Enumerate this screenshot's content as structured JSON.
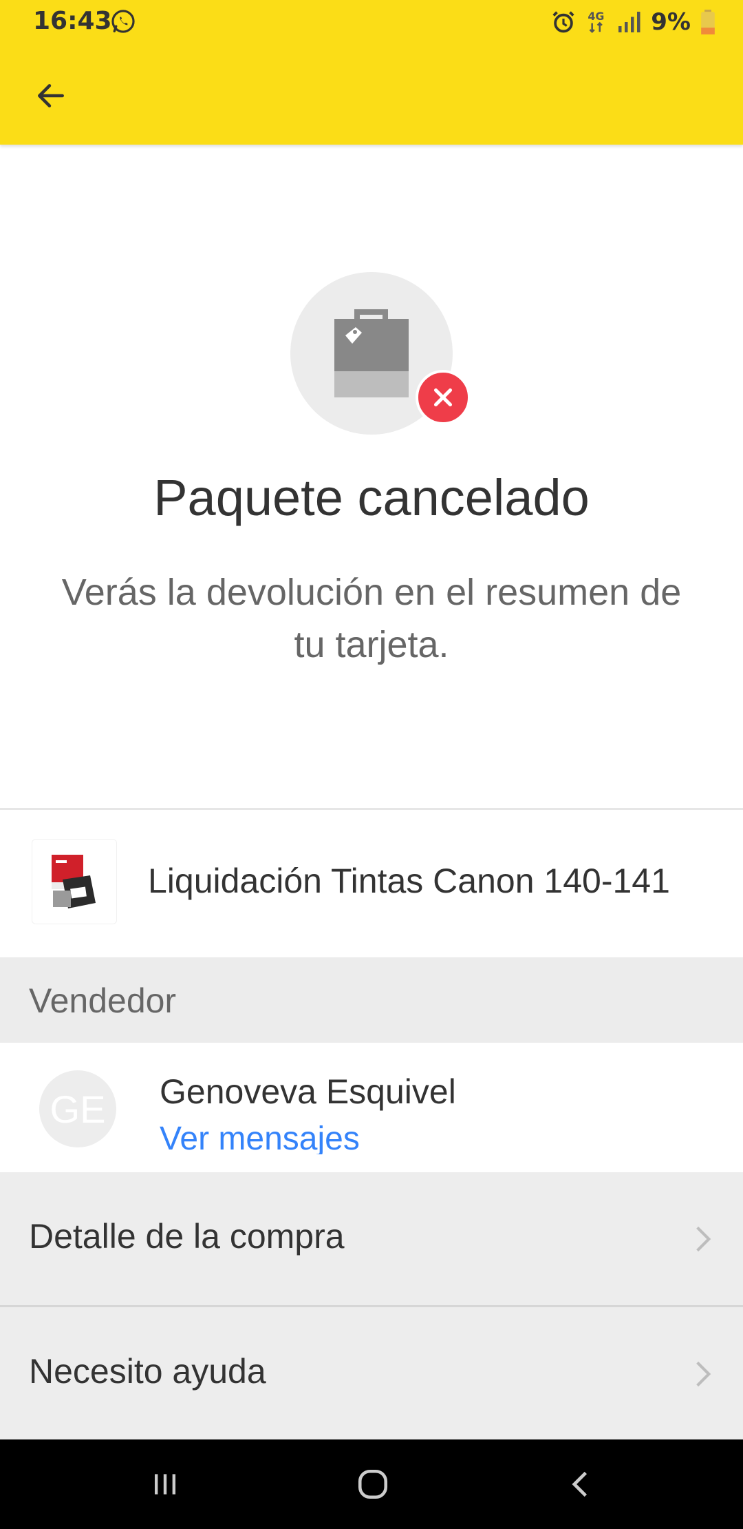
{
  "status_bar": {
    "time": "16:43",
    "battery_text": "9%",
    "network": "4G"
  },
  "toolbar": {
    "back_icon": "arrow-left-icon"
  },
  "status": {
    "icon": "shopping-bag-icon",
    "badge_icon": "close-icon",
    "title": "Paquete cancelado",
    "subtitle": "Verás la devolución en el resumen de tu tarjeta."
  },
  "product": {
    "title": "Liquidación Tintas Canon 140-141"
  },
  "seller_section": {
    "header": "Vendedor",
    "avatar_initials": "GE",
    "name": "Genoveva Esquivel",
    "link": "Ver mensajes"
  },
  "rows": [
    {
      "label": "Detalle de la compra"
    },
    {
      "label": "Necesito ayuda"
    }
  ],
  "colors": {
    "accent_yellow": "#fbdd17",
    "error_red": "#ef3d49",
    "link_blue": "#3483fa"
  }
}
